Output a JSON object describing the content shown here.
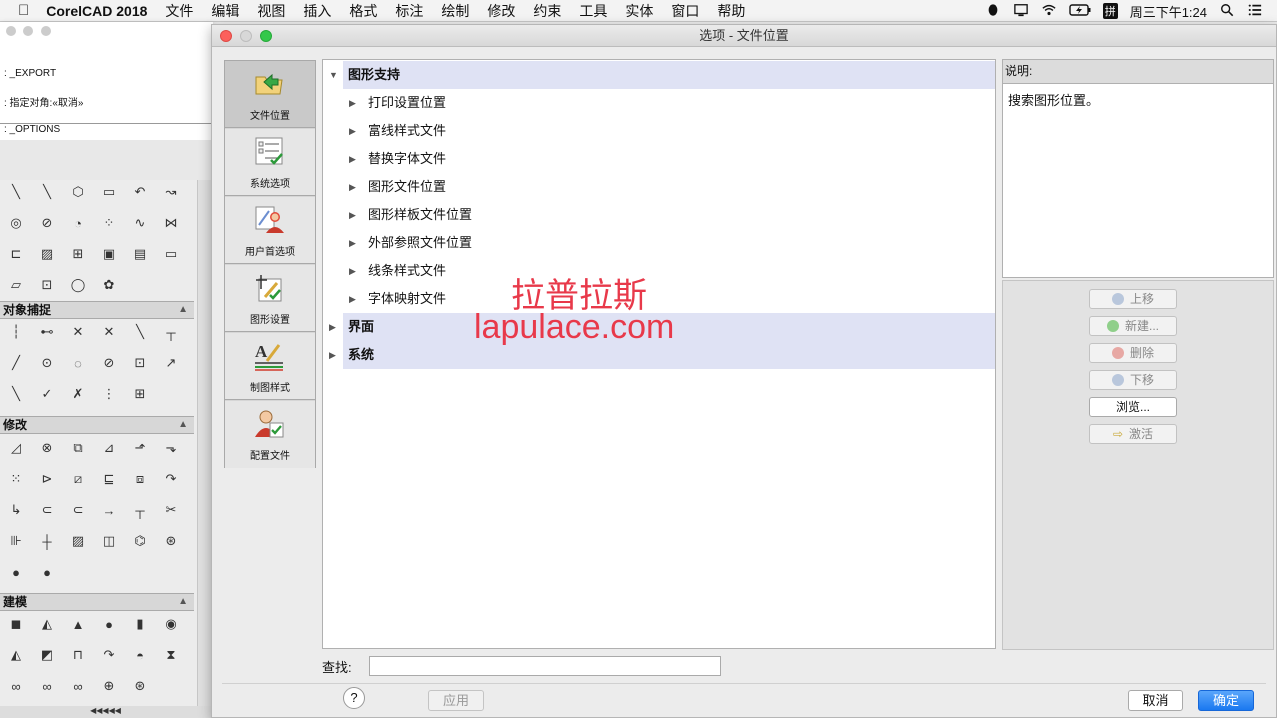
{
  "menubar": {
    "app_name": "CorelCAD 2018",
    "items": [
      "文件",
      "编辑",
      "视图",
      "插入",
      "格式",
      "标注",
      "绘制",
      "修改",
      "约束",
      "工具",
      "实体",
      "窗口",
      "帮助"
    ],
    "clock": "周三下午1:24",
    "input_method": "拼"
  },
  "command_window": {
    "lines": [
      ": _EXPORT",
      ": 指定对角:«取消»",
      ": _OPTIONS"
    ]
  },
  "palette": {
    "sections": [
      {
        "label": "对象捕捉"
      },
      {
        "label": "修改"
      },
      {
        "label": "建模"
      }
    ]
  },
  "dialog": {
    "title": "选项 - 文件位置",
    "nav": [
      {
        "label": "文件位置",
        "selected": true
      },
      {
        "label": "系统选项"
      },
      {
        "label": "用户首选项"
      },
      {
        "label": "图形设置"
      },
      {
        "label": "制图样式"
      },
      {
        "label": "配置文件"
      }
    ],
    "tree": [
      {
        "label": "图形支持",
        "level": 0,
        "expanded": true
      },
      {
        "label": "打印设置位置",
        "level": 1
      },
      {
        "label": "富线样式文件",
        "level": 1
      },
      {
        "label": "替换字体文件",
        "level": 1
      },
      {
        "label": "图形文件位置",
        "level": 1
      },
      {
        "label": "图形样板文件位置",
        "level": 1
      },
      {
        "label": "外部参照文件位置",
        "level": 1
      },
      {
        "label": "线条样式文件",
        "level": 1
      },
      {
        "label": "字体映射文件",
        "level": 1
      },
      {
        "label": "界面",
        "level": 0,
        "expanded": false
      },
      {
        "label": "系统",
        "level": 0,
        "expanded": false
      }
    ],
    "description_label": "说明:",
    "description_text": "搜索图形位置。",
    "buttons": {
      "move_up": "上移",
      "new": "新建...",
      "delete": "删除",
      "move_down": "下移",
      "browse": "浏览...",
      "activate": "激活"
    },
    "find_label": "查找:",
    "find_value": "",
    "help": "?",
    "apply": "应用",
    "cancel": "取消",
    "ok": "确定"
  },
  "watermark": {
    "line1": "拉普拉斯",
    "line2": "lapulace.com"
  },
  "colors": {
    "accent": "#1a78f0",
    "tree_highlight": "#dfe2f4",
    "watermark": "#e8394a"
  }
}
